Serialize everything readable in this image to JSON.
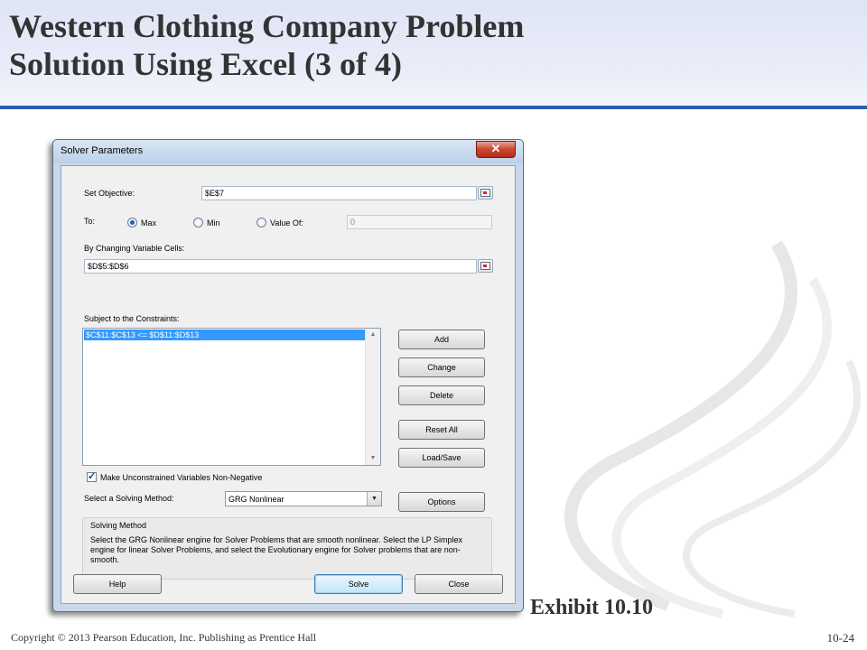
{
  "slide": {
    "title_line1": "Western Clothing Company Problem",
    "title_line2": "Solution Using Excel (3 of  4)",
    "exhibit": "Exhibit 10.10",
    "copyright": "Copyright © 2013 Pearson Education, Inc. Publishing as Prentice Hall",
    "page_number": "10-24",
    "header_rule_color": "#2d5fa8"
  },
  "dialog": {
    "title": "Solver Parameters",
    "close_glyph": "✕",
    "set_objective_label": "Set Objective:",
    "set_objective_value": "$E$7",
    "to_label": "To:",
    "radio_max": "Max",
    "radio_min": "Min",
    "radio_value_of": "Value Of:",
    "selected_goal": "Max",
    "value_of_field": "0",
    "changing_cells_label": "By Changing Variable Cells:",
    "changing_cells_value": "$D$5:$D$6",
    "constraints_label": "Subject to the Constraints:",
    "constraints": [
      "$C$11:$C$13 <= $D$11:$D$13"
    ],
    "buttons": {
      "add": "Add",
      "change": "Change",
      "delete": "Delete",
      "reset_all": "Reset All",
      "load_save": "Load/Save",
      "options": "Options",
      "help": "Help",
      "solve": "Solve",
      "close": "Close"
    },
    "nonnegative_label": "Make Unconstrained Variables Non-Negative",
    "nonnegative_checked": true,
    "solving_method_label": "Select a Solving Method:",
    "solving_method_value": "GRG Nonlinear",
    "group_title": "Solving Method",
    "group_description": "Select the GRG Nonlinear engine for Solver Problems that are smooth nonlinear. Select the LP Simplex engine for linear Solver Problems, and select the Evolutionary engine for Solver problems that are non-smooth."
  }
}
